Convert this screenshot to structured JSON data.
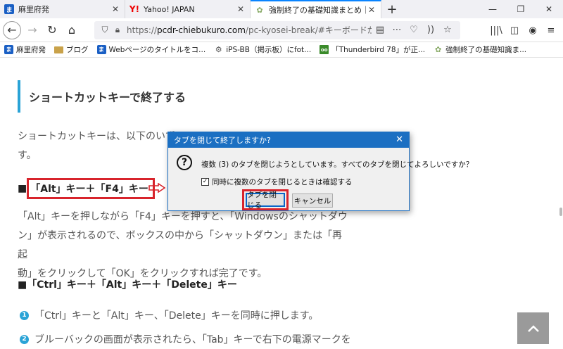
{
  "tabs": [
    {
      "title": "麻里府発",
      "favicon": "ま",
      "active": false
    },
    {
      "title": "Yahoo! JAPAN",
      "favicon": "Y!",
      "active": false
    },
    {
      "title": "強制終了の基礎知識まとめ｜電源",
      "favicon": "✿",
      "active": true
    }
  ],
  "new_tab": "+",
  "window_controls": {
    "minimize": "—",
    "restore": "❐",
    "close": "✕"
  },
  "url": {
    "prefix": "https://",
    "domain": "pcdr-chiebukuro.com",
    "path": "/pc-kyosei-break/#キーボードが操作でき"
  },
  "bookmarks": [
    {
      "label": "麻里府発",
      "icon": "blue"
    },
    {
      "label": "ブログ",
      "icon": "folder"
    },
    {
      "label": "Webページのタイトルをコ...",
      "icon": "blue"
    },
    {
      "label": "iPS-BB（掲示板）にfot...",
      "icon": "gear"
    },
    {
      "label": "「Thunderbird 78」が正...",
      "icon": "green"
    },
    {
      "label": "強制終了の基礎知識ま...",
      "icon": "flower"
    }
  ],
  "article": {
    "heading": "ショートカットキーで終了する",
    "intro_line1": "ショートカットキーは、以下のいず",
    "intro_line2": "す。",
    "square": "■",
    "subheading1": "「Alt」キー＋「F4」キー",
    "para2_line1": "「Alt」キーを押しながら「F4」キーを押すと、「Windowsのシャットダウ",
    "para2_line2": "ン」が表示されるので、ボックスの中から「シャットダウン」または「再起",
    "para2_line3": "動」をクリックして「OK」をクリックすれば完了です。",
    "subheading2": "■「Ctrl」キー＋「Alt」キー＋「Delete」キー",
    "list": [
      {
        "num": "1",
        "text": "「Ctrl」キーと「Alt」キー、「Delete」キーを同時に押します。"
      },
      {
        "num": "2",
        "text": "ブルーバックの画面が表示されたら、「Tab」キーで右下の電源マークを"
      }
    ]
  },
  "dialog": {
    "title": "タブを閉じて終了しますか?",
    "close": "✕",
    "icon": "?",
    "message": "複数 (3) のタブを閉じようとしています。すべてのタブを閉じてよろしいですか？",
    "checkbox_label": "同時に複数のタブを閉じるときは確認する",
    "checkbox_mark": "✓",
    "confirm_button": "タブを閉じる",
    "cancel_button": "キャンセル"
  },
  "colors": {
    "accent": "#2aa3d6",
    "highlight": "#d8242c",
    "dialog_title": "#1b6fc2"
  }
}
